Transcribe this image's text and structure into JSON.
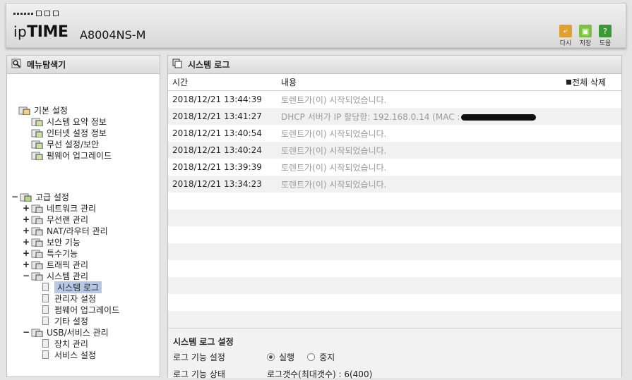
{
  "header": {
    "logo_prefix": "ip",
    "logo_bold": "TIME",
    "model": "A8004NS-M",
    "buttons": [
      {
        "label": "다시",
        "icon": "restart-icon",
        "color": "#e0a030"
      },
      {
        "label": "저장",
        "icon": "save-icon",
        "color": "#7cc142"
      },
      {
        "label": "도움",
        "icon": "help-icon",
        "color": "#3a9a3a"
      }
    ]
  },
  "menu_panel": {
    "title": "메뉴탐색기",
    "basic": {
      "label": "기본 설정",
      "items": [
        "시스템 요약 정보",
        "인터넷 설정 정보",
        "무선 설정/보안",
        "펌웨어 업그레이드"
      ]
    },
    "advanced": {
      "label": "고급 설정",
      "groups": [
        {
          "label": "네트워크 관리",
          "expander": "+"
        },
        {
          "label": "무선랜 관리",
          "expander": "+"
        },
        {
          "label": "NAT/라우터 관리",
          "expander": "+"
        },
        {
          "label": "보안 기능",
          "expander": "+"
        },
        {
          "label": "특수기능",
          "expander": "+"
        },
        {
          "label": "트래픽 관리",
          "expander": "+"
        },
        {
          "label": "시스템 관리",
          "expander": "−"
        }
      ],
      "system_children": [
        "시스템 로그",
        "관리자 설정",
        "펌웨어 업그레이드",
        "기타 설정"
      ],
      "selected": "시스템 로그",
      "usb": {
        "label": "USB/서비스 관리",
        "expander": "−",
        "children": [
          "장치 관리",
          "서비스 설정"
        ]
      }
    },
    "root_expander": "−"
  },
  "log_panel": {
    "title": "시스템 로그",
    "columns": {
      "time": "시간",
      "content": "내용",
      "delete_all": "전체 삭제"
    },
    "rows": [
      {
        "time": "2018/12/21 13:44:39",
        "content": "토렌트가(이) 시작되었습니다.",
        "redacted": false
      },
      {
        "time": "2018/12/21 13:41:27",
        "content": "DHCP 서버가 IP 할당함: 192.168.0.14 (MAC :",
        "redacted": true
      },
      {
        "time": "2018/12/21 13:40:54",
        "content": "토렌트가(이) 시작되었습니다.",
        "redacted": false
      },
      {
        "time": "2018/12/21 13:40:24",
        "content": "토렌트가(이) 시작되었습니다.",
        "redacted": false
      },
      {
        "time": "2018/12/21 13:39:39",
        "content": "토렌트가(이) 시작되었습니다.",
        "redacted": false
      },
      {
        "time": "2018/12/21 13:34:23",
        "content": "토렌트가(이) 시작되었습니다.",
        "redacted": false
      }
    ],
    "empty_rows": 8
  },
  "log_settings": {
    "title": "시스템 로그 설정",
    "function_label": "로그 기능 설정",
    "options": [
      {
        "label": "실행",
        "checked": true
      },
      {
        "label": "중지",
        "checked": false
      }
    ],
    "status_label": "로그 기능 상태",
    "status_value": "로그갯수(최대갯수) : 6(400)"
  }
}
